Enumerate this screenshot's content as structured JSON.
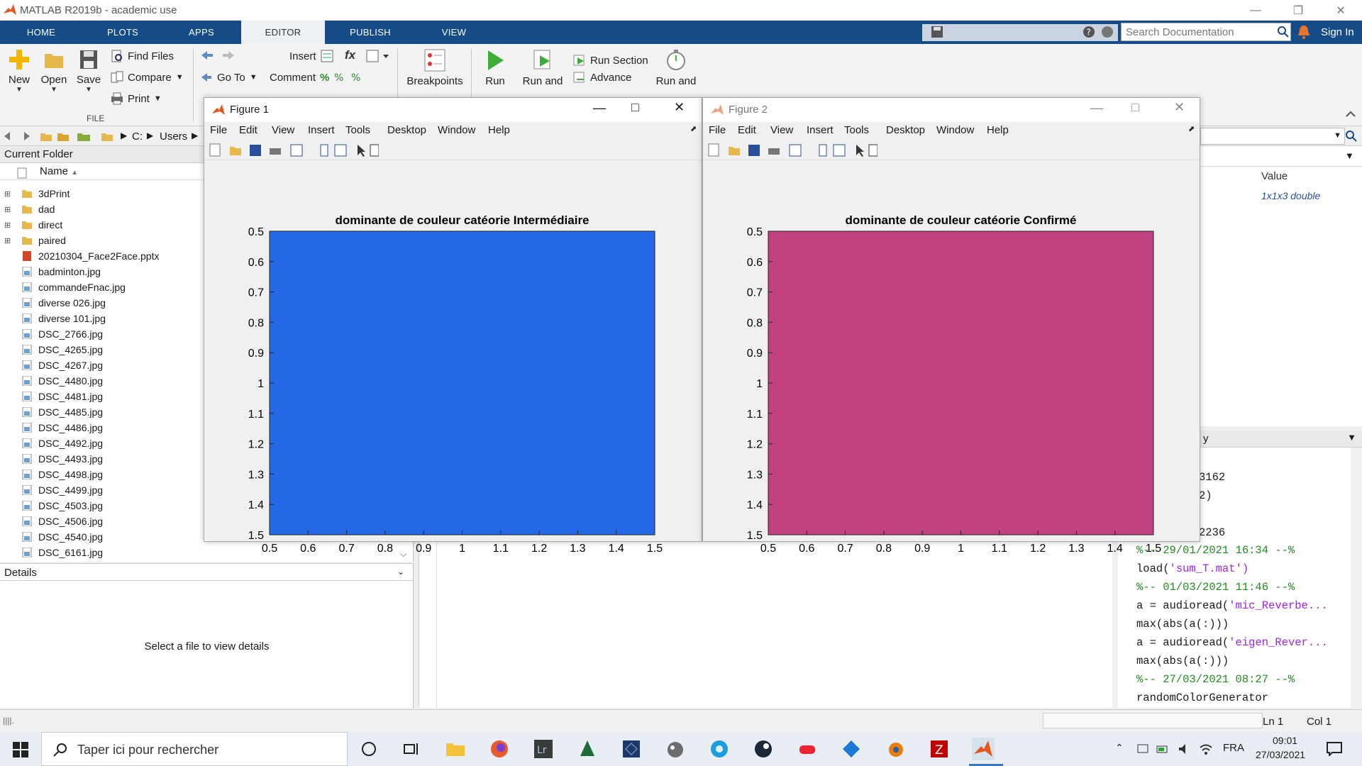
{
  "window": {
    "title": "MATLAB R2019b - academic use"
  },
  "ribbon_tabs": [
    "HOME",
    "PLOTS",
    "APPS",
    "EDITOR",
    "PUBLISH",
    "VIEW"
  ],
  "search": {
    "placeholder": "Search Documentation"
  },
  "sign_in": "Sign In",
  "file_group": {
    "new": "New",
    "open": "Open",
    "save": "Save",
    "find_files": "Find Files",
    "compare": "Compare",
    "print": "Print",
    "label": "FILE"
  },
  "nav_group": {
    "go_to": "Go To"
  },
  "edit_group": {
    "insert": "Insert",
    "comment": "Comment",
    "fx": "fx",
    "percent": "%"
  },
  "breakpoints": "Breakpoints",
  "run_group": {
    "run": "Run",
    "run_and_advance": "Run and",
    "run_section": "Run Section",
    "advance": "Advance",
    "run_and_time": "Run and"
  },
  "address": {
    "drive": "C:",
    "users": "Users"
  },
  "current_folder": {
    "title": "Current Folder",
    "name_col": "Name",
    "folders": [
      "3dPrint",
      "dad",
      "direct",
      "paired"
    ],
    "files": [
      "20210304_Face2Face.pptx",
      "badminton.jpg",
      "commandeFnac.jpg",
      "diverse 026.jpg",
      "diverse 101.jpg",
      "DSC_2766.jpg",
      "DSC_4265.jpg",
      "DSC_4267.jpg",
      "DSC_4480.jpg",
      "DSC_4481.jpg",
      "DSC_4485.jpg",
      "DSC_4486.jpg",
      "DSC_4492.jpg",
      "DSC_4493.jpg",
      "DSC_4498.jpg",
      "DSC_4499.jpg",
      "DSC_4503.jpg",
      "DSC_4506.jpg",
      "DSC_4540.jpg",
      "DSC_6161.jpg"
    ]
  },
  "details": {
    "title": "Details",
    "message": "Select a file to view details"
  },
  "workspace": {
    "value_col": "Value",
    "value": "1x1x3 double"
  },
  "command_history": {
    "partial_title": "y",
    "partial_lines": [
      "3162",
      "2)",
      "2236"
    ],
    "lines": [
      {
        "text": "%-- 29/01/2021 16:34 --%",
        "kind": "sep"
      },
      {
        "text": "load('sum_T.mat')",
        "kind": "cmd"
      },
      {
        "text": "%-- 01/03/2021 11:46 --%",
        "kind": "sep"
      },
      {
        "text": "a = audioread('mic_Reverbe...",
        "kind": "cmd"
      },
      {
        "text": "max(abs(a(:)))",
        "kind": "cmd"
      },
      {
        "text": "a = audioread('eigen_Rever...",
        "kind": "cmd"
      },
      {
        "text": "max(abs(a(:)))",
        "kind": "cmd"
      },
      {
        "text": "%-- 27/03/2021 08:27 --%",
        "kind": "sep"
      },
      {
        "text": "randomColorGenerator",
        "kind": "cmd"
      }
    ]
  },
  "status": {
    "ln": "Ln  1",
    "col": "Col  1"
  },
  "figure_menu": [
    "File",
    "Edit",
    "View",
    "Insert",
    "Tools",
    "Desktop",
    "Window",
    "Help"
  ],
  "figures": [
    {
      "title": "Figure 1",
      "axes_title": "dominante de couleur catéorie Intermédiaire",
      "fill": "#2468e8",
      "xticks": [
        "0.5",
        "0.6",
        "0.7",
        "0.8",
        "0.9",
        "1",
        "1.1",
        "1.2",
        "1.3",
        "1.4",
        "1.5"
      ],
      "yticks": [
        "0.5",
        "0.6",
        "0.7",
        "0.8",
        "0.9",
        "1",
        "1.1",
        "1.2",
        "1.3",
        "1.4",
        "1.5"
      ]
    },
    {
      "title": "Figure 2",
      "axes_title": "dominante de couleur catéorie Confirmé",
      "fill": "#c24180",
      "xticks": [
        "0.5",
        "0.6",
        "0.7",
        "0.8",
        "0.9",
        "1",
        "1.1",
        "1.2",
        "1.3",
        "1.4",
        "1.5"
      ],
      "yticks": [
        "0.5",
        "0.6",
        "0.7",
        "0.8",
        "0.9",
        "1",
        "1.1",
        "1.2",
        "1.3",
        "1.4",
        "1.5"
      ]
    }
  ],
  "taskbar": {
    "search_placeholder": "Taper ici pour rechercher",
    "lang": "FRA",
    "time": "09:01",
    "date": "27/03/2021"
  },
  "colors": {
    "ribbon_blue": "#154b87",
    "cmd_purple": "#a020f0",
    "separator_green": "#228b22"
  }
}
